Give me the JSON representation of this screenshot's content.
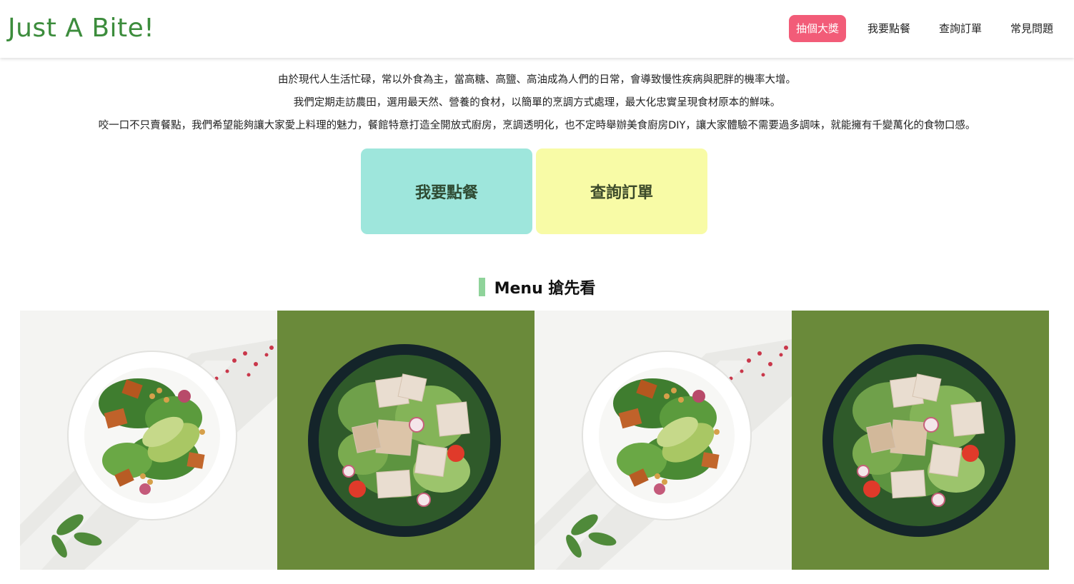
{
  "header": {
    "logo": "Just A Bite!",
    "nav": [
      {
        "label": "抽個大獎",
        "active": true
      },
      {
        "label": "我要點餐",
        "active": false
      },
      {
        "label": "查詢訂單",
        "active": false
      },
      {
        "label": "常見問題",
        "active": false
      }
    ]
  },
  "intro": {
    "lines": [
      "由於現代人生活忙碌，常以外食為主，當高糖、高鹽、高油成為人們的日常，會導致慢性疾病與肥胖的機率大增。",
      "我們定期走訪農田，選用最天然、營養的食材，以簡單的烹調方式處理，最大化忠實呈現食材原本的鮮味。",
      "咬一口不只賣餐點，我們希望能夠讓大家愛上料理的魅力，餐館特意打造全開放式廚房，烹調透明化，也不定時舉辦美食廚房DIY，讓大家體驗不需要過多調味，就能擁有千變萬化的食物口感。"
    ]
  },
  "cta": {
    "order_label": "我要點餐",
    "query_label": "查詢訂單"
  },
  "menu": {
    "title": "Menu 搶先看",
    "photos": [
      "salad-white-bowl",
      "salad-dark-bowl",
      "salad-white-bowl",
      "salad-dark-bowl"
    ]
  },
  "colors": {
    "logo": "#3c8c3c",
    "nav_active_bg": "#f25c78",
    "cta_order_bg": "#9ee6dc",
    "cta_query_bg": "#f8fba6",
    "menu_accent": "#8fd39a"
  }
}
